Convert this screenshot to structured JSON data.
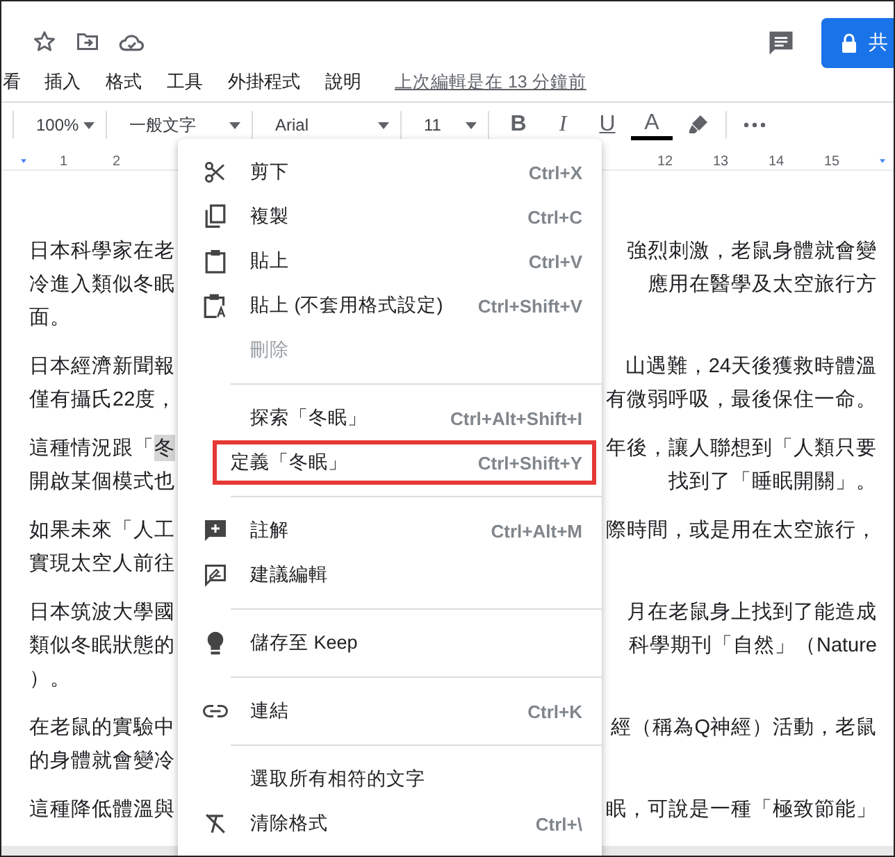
{
  "header": {
    "share_button": "共"
  },
  "menu_bar": {
    "items": [
      "看",
      "插入",
      "格式",
      "工具",
      "外掛程式",
      "說明"
    ],
    "last_edit": "上次編輯是在 13 分鐘前"
  },
  "toolbar": {
    "zoom": "100%",
    "style": "一般文字",
    "font": "Arial",
    "size": "11",
    "format_buttons": [
      "B",
      "I",
      "U",
      "A"
    ]
  },
  "ruler": {
    "left_numbers": [
      "1",
      "2"
    ],
    "right_numbers": [
      "12",
      "13",
      "14",
      "15"
    ]
  },
  "document": {
    "paragraphs": [
      {
        "lines": [
          {
            "left": "日本科學家在老",
            "right": "強烈刺激，老鼠身體就會變"
          },
          {
            "left": "冷進入類似冬眠",
            "right": "應用在醫學及太空旅行方"
          },
          {
            "left": "面。"
          }
        ]
      },
      {
        "lines": [
          {
            "left": "日本經濟新聞報",
            "right": "山遇難，24天後獲救時體溫"
          },
          {
            "left": "僅有攝氏22度，",
            "right": "有微弱呼吸，最後保住一命。"
          }
        ]
      },
      {
        "lines": [
          {
            "left": "這種情況跟「",
            "selected_text": "冬",
            "right": "年後，讓人聯想到「人類只要"
          },
          {
            "left": "開啟某個模式也",
            "right": "找到了「睡眠開關」。"
          }
        ]
      },
      {
        "lines": [
          {
            "left": "如果未來「人工",
            "right": "際時間，或是用在太空旅行，"
          },
          {
            "left": "實現太空人前往"
          }
        ]
      },
      {
        "lines": [
          {
            "left": "日本筑波大學國",
            "right": "月在老鼠身上找到了能造成"
          },
          {
            "left": "類似冬眠狀態的",
            "right": "科學期刊「自然」（Nature"
          },
          {
            "left": "）。"
          }
        ]
      },
      {
        "lines": [
          {
            "left": "在老鼠的實驗中",
            "right": "經（稱為Q神經）活動，老鼠"
          },
          {
            "left": "的身體就會變冷"
          }
        ]
      },
      {
        "lines": [
          {
            "left": "這種降低體溫與",
            "right": "眠，可說是一種「極致節能」"
          }
        ]
      }
    ]
  },
  "context_menu": {
    "items": [
      {
        "kind": "item",
        "label": "剪下",
        "shortcut": "Ctrl+X",
        "disabled": false,
        "highlighted": false
      },
      {
        "kind": "item",
        "label": "複製",
        "shortcut": "Ctrl+C",
        "disabled": false,
        "highlighted": false
      },
      {
        "kind": "item",
        "label": "貼上",
        "shortcut": "Ctrl+V",
        "disabled": false,
        "highlighted": false
      },
      {
        "kind": "item",
        "label": "貼上 (不套用格式設定)",
        "shortcut": "Ctrl+Shift+V",
        "disabled": false,
        "highlighted": false
      },
      {
        "kind": "item",
        "label": "刪除",
        "disabled": true,
        "highlighted": false
      },
      {
        "kind": "separator"
      },
      {
        "kind": "item",
        "label": "探索「冬眠」",
        "shortcut": "Ctrl+Alt+Shift+I",
        "disabled": false,
        "highlighted": false
      },
      {
        "kind": "item",
        "label": "定義「冬眠」",
        "shortcut": "Ctrl+Shift+Y",
        "disabled": false,
        "highlighted": true
      },
      {
        "kind": "separator"
      },
      {
        "kind": "item",
        "label": "註解",
        "shortcut": "Ctrl+Alt+M",
        "disabled": false,
        "highlighted": false
      },
      {
        "kind": "item",
        "label": "建議編輯",
        "disabled": false,
        "highlighted": false
      },
      {
        "kind": "separator"
      },
      {
        "kind": "item",
        "label": "儲存至 Keep",
        "disabled": false,
        "highlighted": false
      },
      {
        "kind": "separator"
      },
      {
        "kind": "item",
        "label": "連結",
        "shortcut": "Ctrl+K",
        "disabled": false,
        "highlighted": false
      },
      {
        "kind": "separator"
      },
      {
        "kind": "item",
        "label": "選取所有相符的文字",
        "disabled": false,
        "highlighted": false
      },
      {
        "kind": "item",
        "label": "清除格式",
        "shortcut": "Ctrl+\\",
        "disabled": false,
        "highlighted": false
      }
    ]
  }
}
